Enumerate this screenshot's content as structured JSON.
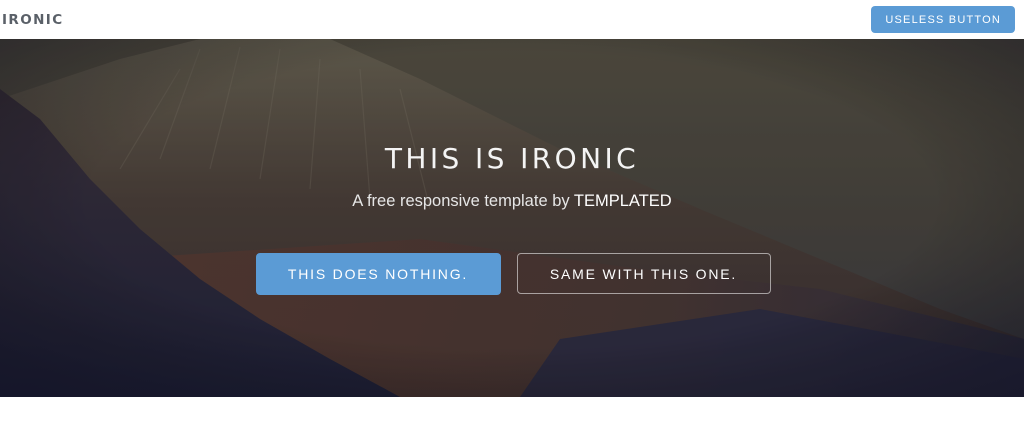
{
  "header": {
    "brand": "IRONIC",
    "button_label": "USELESS BUTTON"
  },
  "hero": {
    "title": "THIS IS IRONIC",
    "subtitle_prefix": "A free responsive template by ",
    "subtitle_brand": "TEMPLATED",
    "primary_button": "THIS DOES NOTHING.",
    "secondary_button": "SAME WITH THIS ONE."
  },
  "colors": {
    "accent": "#5b9bd5",
    "brand_text": "#5a6068"
  }
}
